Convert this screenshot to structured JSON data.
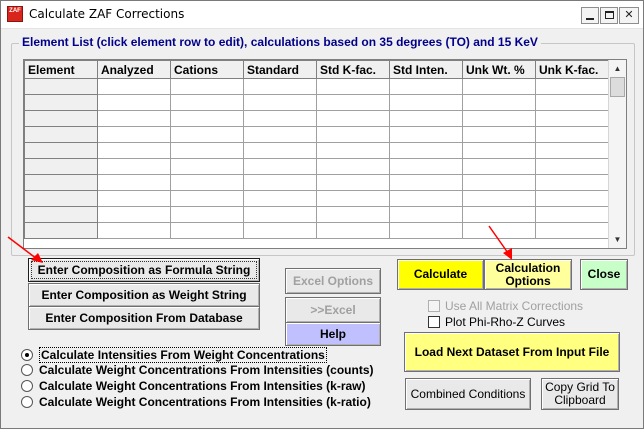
{
  "window": {
    "title": "Calculate ZAF Corrections",
    "icon_text": "ZAF"
  },
  "group": {
    "label": "Element List (click element row to edit), calculations based on  35 degrees (TO) and  15 KeV"
  },
  "grid": {
    "columns": [
      "Element",
      "Analyzed",
      "Cations",
      "Standard",
      "Std K-fac.",
      "Std Inten.",
      "Unk Wt. %",
      "Unk K-fac."
    ],
    "row_count": 10
  },
  "buttons": {
    "formula": "Enter Composition as Formula String",
    "weight": "Enter Composition as Weight String",
    "database": "Enter Composition From Database",
    "excel_options": "Excel Options",
    "excel": ">>Excel",
    "help": "Help",
    "calculate": "Calculate",
    "calc_options": "Calculation Options",
    "close": "Close",
    "load_next": "Load Next Dataset From Input File",
    "combined": "Combined Conditions",
    "copy_grid": "Copy Grid To Clipboard"
  },
  "checks": {
    "matrix": "Use All Matrix Corrections",
    "phirhoz": "Plot Phi-Rho-Z Curves"
  },
  "radios": [
    {
      "label": "Calculate Intensities From Weight Concentrations",
      "selected": true
    },
    {
      "label": "Calculate Weight Concentrations From Intensities (counts)",
      "selected": false
    },
    {
      "label": "Calculate Weight Concentrations From Intensities (k-raw)",
      "selected": false
    },
    {
      "label": "Calculate Weight Concentrations From Intensities (k-ratio)",
      "selected": false
    }
  ],
  "colors": {
    "accent_label": "#00008b",
    "arrow": "#ff0000",
    "calculate_bg": "#ffff00",
    "close_bg": "#c8ffc8",
    "help_bg": "#c0c0ff"
  }
}
